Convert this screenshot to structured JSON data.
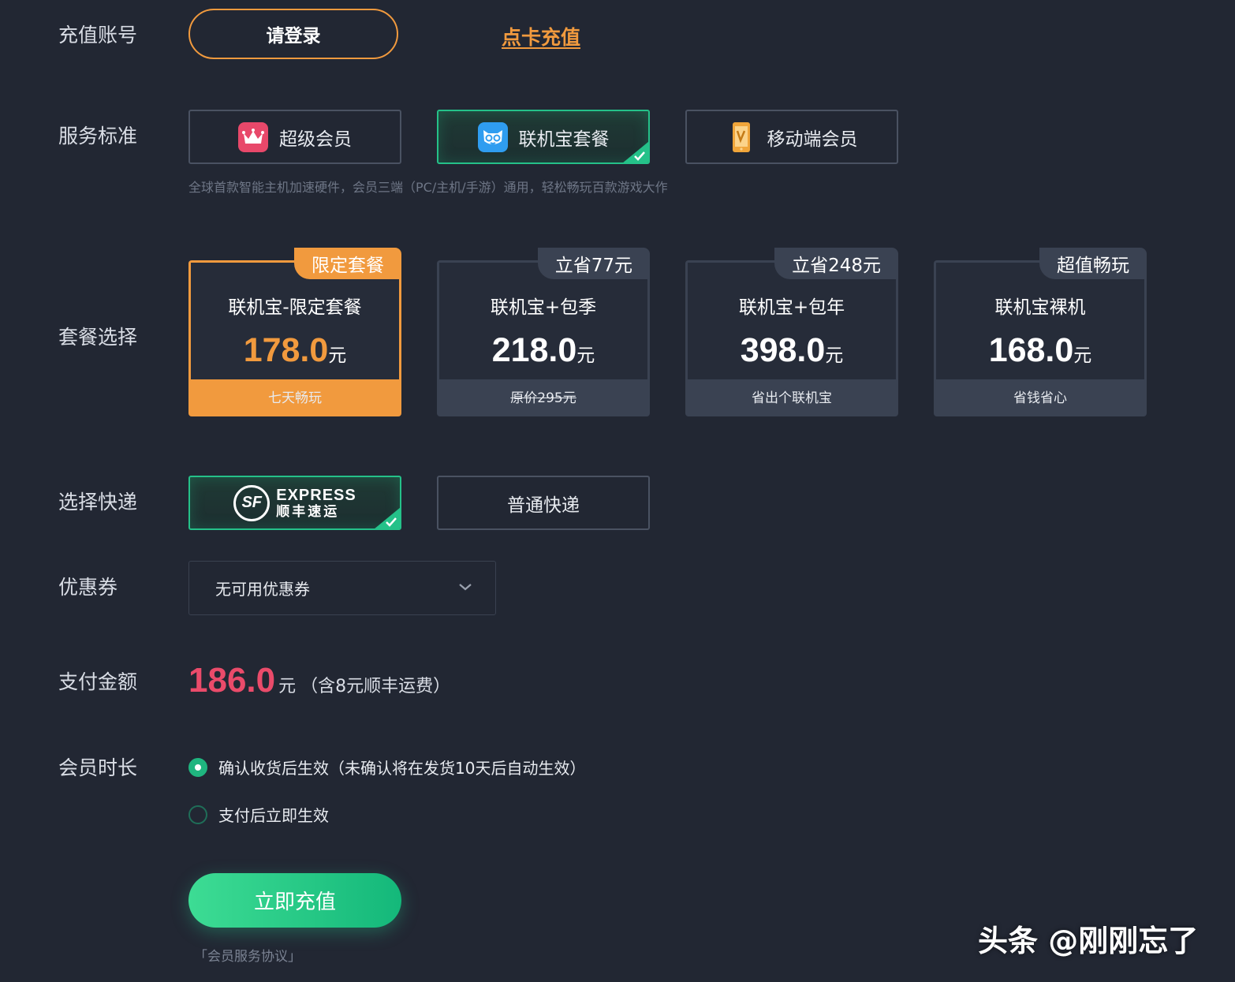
{
  "account": {
    "label": "充值账号",
    "login_button": "请登录",
    "card_recharge_link": "点卡充值"
  },
  "service": {
    "label": "服务标准",
    "options": [
      {
        "name": "超级会员",
        "icon": "crown-icon",
        "selected": false
      },
      {
        "name": "联机宝套餐",
        "icon": "lianjibao-face-icon",
        "selected": true
      },
      {
        "name": "移动端会员",
        "icon": "mobile-vip-icon",
        "selected": false
      }
    ],
    "description": "全球首款智能主机加速硬件，会员三端（PC/主机/手游）通用，轻松畅玩百款游戏大作"
  },
  "packages": {
    "label": "套餐选择",
    "items": [
      {
        "badge": "限定套餐",
        "name": "联机宝-限定套餐",
        "price": "178.0",
        "unit": "元",
        "footer": "七天畅玩",
        "selected": true,
        "strike": false
      },
      {
        "badge": "立省77元",
        "name": "联机宝+包季",
        "price": "218.0",
        "unit": "元",
        "footer": "原价295元",
        "selected": false,
        "strike": true
      },
      {
        "badge": "立省248元",
        "name": "联机宝+包年",
        "price": "398.0",
        "unit": "元",
        "footer": "省出个联机宝",
        "selected": false,
        "strike": false
      },
      {
        "badge": "超值畅玩",
        "name": "联机宝裸机",
        "price": "168.0",
        "unit": "元",
        "footer": "省钱省心",
        "selected": false,
        "strike": false
      }
    ]
  },
  "express": {
    "label": "选择快递",
    "sf": {
      "logo_letters": "SF",
      "logo_en": "EXPRESS",
      "logo_cn": "顺丰速运",
      "selected": true
    },
    "normal": {
      "name": "普通快递",
      "selected": false
    }
  },
  "coupon": {
    "label": "优惠券",
    "value": "无可用优惠券"
  },
  "payment": {
    "label": "支付金额",
    "amount": "186.0",
    "unit": "元",
    "note": "（含8元顺丰运费）"
  },
  "duration": {
    "label": "会员时长",
    "options": [
      {
        "text": "确认收货后生效（未确认将在发货10天后自动生效）",
        "selected": true
      },
      {
        "text": "支付后立即生效",
        "selected": false
      }
    ]
  },
  "submit_button": "立即充值",
  "agreement_link": "「会员服务协议」",
  "watermark": "头条 @刚刚忘了",
  "colors": {
    "background": "#222733",
    "accent_orange": "#f19a3e",
    "accent_green": "#25c189",
    "price_red": "#ea4b6a"
  }
}
